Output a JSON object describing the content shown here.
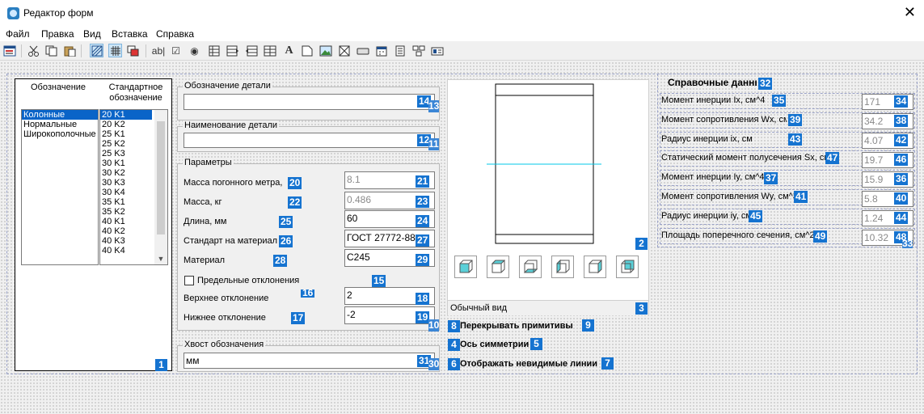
{
  "window": {
    "title": "Редактор форм",
    "close_glyph": "✕"
  },
  "menu": [
    "Файл",
    "Правка",
    "Вид",
    "Вставка",
    "Справка"
  ],
  "toolbar": {
    "icons": [
      "form-icon",
      "scissors-icon",
      "copy-icon",
      "paste-icon",
      "hatch-icon",
      "grid-icon",
      "overlap-icon",
      "textbox-icon",
      "checkbox-icon",
      "radio-icon",
      "table-icon",
      "table-right-icon",
      "table-left-icon",
      "table-columns-icon",
      "text-icon",
      "frame-icon",
      "image-icon",
      "placeholder-icon",
      "button-icon",
      "calendar-icon",
      "document-icon",
      "group-icon",
      "properties-icon"
    ],
    "labels": {
      "textbox": "ab|",
      "checkbox": "☑",
      "radio": "◉",
      "text": "A"
    }
  },
  "left_panel": {
    "col1_header": "Обозначение",
    "col2_header": "Стандартное обозначение",
    "types": [
      "Колонные",
      "Нормальные",
      "Широкополочные"
    ],
    "selected_type": 0,
    "designations": [
      "20 K1",
      "20 K2",
      "25 K1",
      "25 K2",
      "25 K3",
      "30 K1",
      "30 K2",
      "30 K3",
      "30 K4",
      "35 K1",
      "35 K2",
      "40 K1",
      "40 K2",
      "40 K3",
      "40 K4"
    ],
    "selected_designation": 0,
    "badge": "1"
  },
  "detail_designation": {
    "legend": "Обозначение детали",
    "value": "",
    "badge": "14",
    "badge_hidden": "13"
  },
  "detail_name": {
    "legend": "Наименование детали",
    "value": "",
    "badge": "12",
    "badge_hidden": "11"
  },
  "params": {
    "legend": "Параметры",
    "rows": [
      {
        "label": "Масса погонного метра,",
        "label_badge": "20",
        "value": "8.1",
        "value_badge": "21",
        "readonly": true
      },
      {
        "label": "Масса, кг",
        "label_badge": "22",
        "value": "0.486",
        "value_badge": "23",
        "readonly": true
      },
      {
        "label": "Длина, мм",
        "label_badge": "25",
        "value": "60",
        "value_badge": "24",
        "readonly": false
      },
      {
        "label": "Стандарт на материал",
        "label_badge": "26",
        "value": "ГОСТ 27772-88",
        "value_badge": "27",
        "readonly": false
      },
      {
        "label": "Материал",
        "label_badge": "28",
        "value": "С245",
        "value_badge": "29",
        "readonly": false
      }
    ],
    "limits_checkbox": "Предельные отклонения",
    "limits_badge": "15",
    "upper_label": "Верхнее отклонение",
    "upper_label_badge": "16",
    "upper_value": "2",
    "upper_badge": "18",
    "lower_label": "Нижнее отклонение",
    "lower_label_badge": "17",
    "lower_value": "-2",
    "lower_badge": "19",
    "lower_badge_hidden": "10"
  },
  "tail": {
    "legend": "Хвост обозначения",
    "value": "мм",
    "badge": "31",
    "badge_hidden": "30"
  },
  "preview": {
    "badge": "2",
    "view_label": "Обычный вид",
    "view_badge": "3"
  },
  "options": [
    {
      "badge": "8",
      "label": "Перекрывать примитивы",
      "label_badge": "9"
    },
    {
      "badge": "4",
      "label": "Ось симметрии",
      "label_badge": "5"
    },
    {
      "badge": "6",
      "label": "Отображать невидимые линии",
      "label_badge": "7"
    }
  ],
  "reference": {
    "title": "Справочные данные",
    "title_badge": "32",
    "rows": [
      {
        "label": "Момент инерции Ix, см^4",
        "label_badge": "35",
        "value": "171",
        "value_badge": "34"
      },
      {
        "label": "Момент сопротивления Wx, см^3",
        "label_badge": "39",
        "value": "34.2",
        "value_badge": "38"
      },
      {
        "label": "Радиус инерции ix, см",
        "label_badge": "43",
        "value": "4.07",
        "value_badge": "42"
      },
      {
        "label": "Статический момент полусечения Sx, см^3",
        "label_badge": "47",
        "value": "19.7",
        "value_badge": "46"
      },
      {
        "label": "Момент инерции Iy, см^4",
        "label_badge": "37",
        "value": "15.9",
        "value_badge": "36"
      },
      {
        "label": "Момент сопротивления Wy, см^3",
        "label_badge": "41",
        "value": "5.8",
        "value_badge": "40"
      },
      {
        "label": "Радиус инерции iy, см",
        "label_badge": "45",
        "value": "1.24",
        "value_badge": "44"
      },
      {
        "label": "Площадь поперечного сечения, см^2",
        "label_badge": "49",
        "value": "10.32",
        "value_badge": "48"
      }
    ],
    "extra_badge": "33"
  },
  "colors": {
    "badge": "#1573d0",
    "selection": "#0a64c8",
    "axis": "#00c8e8",
    "cube_face": "#5ad0d8"
  }
}
